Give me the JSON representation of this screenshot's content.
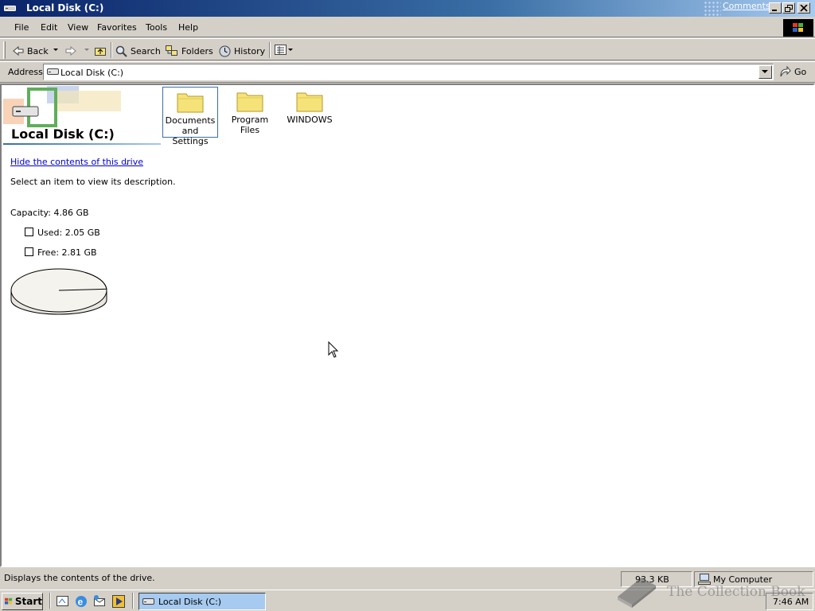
{
  "window": {
    "title": "Local Disk (C:)",
    "comments_link": "Comments?"
  },
  "menu": [
    "File",
    "Edit",
    "View",
    "Favorites",
    "Tools",
    "Help"
  ],
  "toolbar": {
    "back": "Back",
    "search": "Search",
    "folders": "Folders",
    "history": "History"
  },
  "address": {
    "label": "Address",
    "value": "Local Disk (C:)",
    "go": "Go"
  },
  "pane": {
    "title": "Local Disk (C:)",
    "hide_link": "Hide the contents of this drive",
    "hide_link_suffix": ".",
    "description": "Select an item to view its description.",
    "capacity": "Capacity: 4.86 GB",
    "used": "Used: 2.05 GB",
    "free": "Free: 2.81 GB",
    "used_fraction": 0.42
  },
  "folders": [
    {
      "name_line1": "Documents",
      "name_line2": "and Settings",
      "selected": true
    },
    {
      "name_line1": "Program Files",
      "name_line2": "",
      "selected": false
    },
    {
      "name_line1": "WINDOWS",
      "name_line2": "",
      "selected": false
    }
  ],
  "status": {
    "message": "Displays the contents of the drive.",
    "size": "93.3 KB",
    "zone": "My Computer"
  },
  "taskbar": {
    "start": "Start",
    "task": "Local Disk (C:)",
    "clock": "7:46 AM"
  },
  "watermark": "The Collection Book",
  "colors": {
    "titlebar_start": "#0a246a",
    "titlebar_end": "#a6caf0",
    "selection": "#3a6ea5",
    "link": "#0000cc",
    "folder": "#f5e37a"
  }
}
